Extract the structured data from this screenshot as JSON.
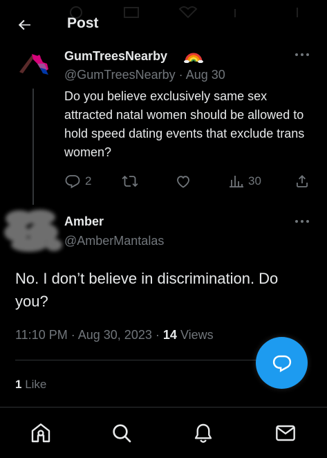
{
  "header": {
    "title": "Post",
    "back_icon": "arrow-left-icon"
  },
  "parent_tweet": {
    "display_name": "GumTreesNearby",
    "name_emoji": "rainbow-icon",
    "handle": "@GumTreesNearby",
    "separator": "·",
    "date": "Aug 30",
    "text": "Do you believe exclusively same sex attracted natal women should be allowed to hold speed dating events that exclude trans women?",
    "reply_count": "2",
    "retweet_count": "",
    "like_count": "",
    "view_count": "30"
  },
  "reply_tweet": {
    "display_name": "Amber",
    "handle": "@AmberMantalas",
    "text": "No. I don’t believe in discrimination. Do you?",
    "time": "11:10 PM",
    "separator": "·",
    "date": "Aug 30, 2023",
    "views_count": "14",
    "views_label": "Views",
    "likes_count": "1",
    "likes_label": "Like"
  },
  "colors": {
    "background": "#000000",
    "text_primary": "#e7e9ea",
    "text_secondary": "#71767b",
    "accent": "#1d9bf0",
    "divider": "#2f3336"
  },
  "nav": {
    "items": [
      "home-icon",
      "search-icon",
      "notifications-icon",
      "messages-icon"
    ]
  }
}
